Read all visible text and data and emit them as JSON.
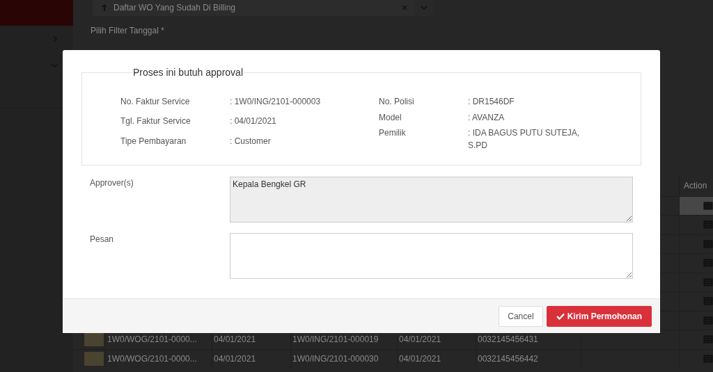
{
  "sidebar": {
    "items": [
      {
        "expanded": false
      },
      {
        "expanded": true
      }
    ]
  },
  "filter": {
    "value": "Daftar WO Yang Sudah Di Billing",
    "date_label": "Pilih Filter Tanggal *"
  },
  "table": {
    "columns": [
      {
        "label": "Action"
      }
    ],
    "rows": [
      {
        "selected": true,
        "cells": []
      },
      {
        "selected": false,
        "cells": []
      },
      {
        "selected": false,
        "cells": []
      },
      {
        "selected": false,
        "cells": []
      },
      {
        "selected": false,
        "cells": []
      },
      {
        "selected": false,
        "cells": []
      },
      {
        "selected": false,
        "cells": []
      },
      {
        "selected": false,
        "cells": [
          "1W0/WOG/2101-0000...",
          "04/01/2021",
          "1W0/ING/2101-000019",
          "04/01/2021",
          "0032145456431"
        ]
      },
      {
        "selected": false,
        "cells": [
          "1W0/WOG/2101-0000...",
          "04/01/2021",
          "1W0/ING/2101-000030",
          "04/01/2021",
          "0032145456442"
        ]
      }
    ]
  },
  "dialog": {
    "legend": "Proses ini butuh approval",
    "info_left": [
      {
        "label": "No. Faktur Service",
        "value": ": 1W0/ING/2101-000003"
      },
      {
        "label": "Tgl. Faktur Service",
        "value": ": 04/01/2021"
      },
      {
        "label": "Tipe Pembayaran",
        "value": ": Customer"
      }
    ],
    "info_right": [
      {
        "label": "No. Polisi",
        "value": ": DR1546DF"
      },
      {
        "label": "Model",
        "value": ": AVANZA"
      },
      {
        "label": "Pemilik",
        "value": ": IDA BAGUS PUTU SUTEJA, S.PD"
      }
    ],
    "fields": [
      {
        "label": "Approver(s)",
        "value": "Kepala Bengkel GR",
        "disabled": true
      },
      {
        "label": "Pesan",
        "disabled": false
      }
    ],
    "buttons": [
      {
        "label": "Cancel",
        "kind": "default"
      },
      {
        "label": "Kirim Permohonan",
        "kind": "primary"
      }
    ]
  }
}
